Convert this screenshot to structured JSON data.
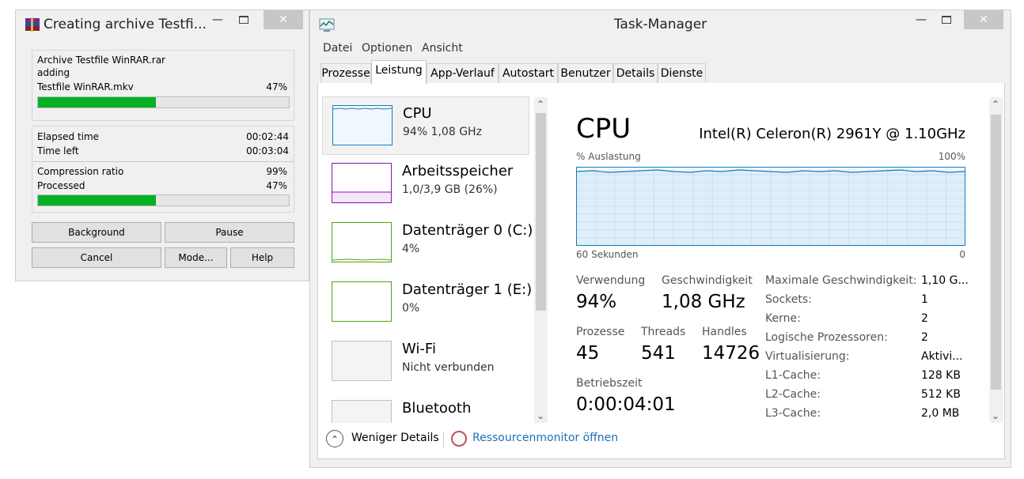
{
  "winrar": {
    "title": "Creating archive Testfi...",
    "archive_name": "Archive Testfile WinRAR.rar",
    "action": "adding",
    "file_name": "Testfile WinRAR.mkv",
    "file_percent": "47%",
    "file_progress": 0.47,
    "elapsed_label": "Elapsed time",
    "elapsed_value": "00:02:44",
    "left_label": "Time left",
    "left_value": "00:03:04",
    "ratio_label": "Compression ratio",
    "ratio_value": "99%",
    "processed_label": "Processed",
    "processed_value": "47%",
    "processed_progress": 0.47,
    "buttons": {
      "background": "Background",
      "pause": "Pause",
      "cancel": "Cancel",
      "mode": "Mode...",
      "help": "Help"
    }
  },
  "taskmanager": {
    "title": "Task-Manager",
    "menu": [
      "Datei",
      "Optionen",
      "Ansicht"
    ],
    "tabs": [
      "Prozesse",
      "Leistung",
      "App-Verlauf",
      "Autostart",
      "Benutzer",
      "Details",
      "Dienste"
    ],
    "active_tab": "Leistung",
    "sidebar": [
      {
        "name": "CPU",
        "sub": "94%  1,08 GHz",
        "color": "#117dbb"
      },
      {
        "name": "Arbeitsspeicher",
        "sub": "1,0/3,9 GB (26%)",
        "color": "#8b12ae"
      },
      {
        "name": "Datenträger 0 (C:)",
        "sub": "4%",
        "color": "#4da60c"
      },
      {
        "name": "Datenträger 1 (E:)",
        "sub": "0%",
        "color": "#4da60c"
      },
      {
        "name": "Wi-Fi",
        "sub": "Nicht verbunden",
        "color": "#c0c0c0"
      },
      {
        "name": "Bluetooth",
        "sub": "",
        "color": "#c0c0c0"
      }
    ],
    "cpu": {
      "heading": "CPU",
      "model": "Intel(R) Celeron(R) 2961Y @ 1.10GHz",
      "graph_label": "% Auslastung",
      "graph_max": "100%",
      "graph_time": "60 Sekunden",
      "graph_min": "0",
      "usage_levels": [
        0.94,
        0.95,
        0.93,
        0.94,
        0.95,
        0.96,
        0.94,
        0.93,
        0.95,
        0.94,
        0.96,
        0.95,
        0.94,
        0.93,
        0.95,
        0.94,
        0.95,
        0.93,
        0.94,
        0.95,
        0.96,
        0.94,
        0.95,
        0.93,
        0.94
      ],
      "stats": {
        "usage_label": "Verwendung",
        "usage_value": "94%",
        "speed_label": "Geschwindigkeit",
        "speed_value": "1,08 GHz",
        "processes_label": "Prozesse",
        "processes_value": "45",
        "threads_label": "Threads",
        "threads_value": "541",
        "handles_label": "Handles",
        "handles_value": "14726",
        "uptime_label": "Betriebszeit",
        "uptime_value": "0:00:04:01"
      },
      "details": [
        {
          "k": "Maximale Geschwindigkeit:",
          "v": "1,10 G..."
        },
        {
          "k": "Sockets:",
          "v": "1"
        },
        {
          "k": "Kerne:",
          "v": "2"
        },
        {
          "k": "Logische Prozessoren:",
          "v": "2"
        },
        {
          "k": "Virtualisierung:",
          "v": "Aktivi..."
        },
        {
          "k": "L1-Cache:",
          "v": "128 KB"
        },
        {
          "k": "L2-Cache:",
          "v": "512 KB"
        },
        {
          "k": "L3-Cache:",
          "v": "2,0 MB"
        }
      ]
    },
    "footer": {
      "fewer_details": "Weniger Details",
      "resource_monitor": "Ressourcenmonitor öffnen"
    }
  }
}
